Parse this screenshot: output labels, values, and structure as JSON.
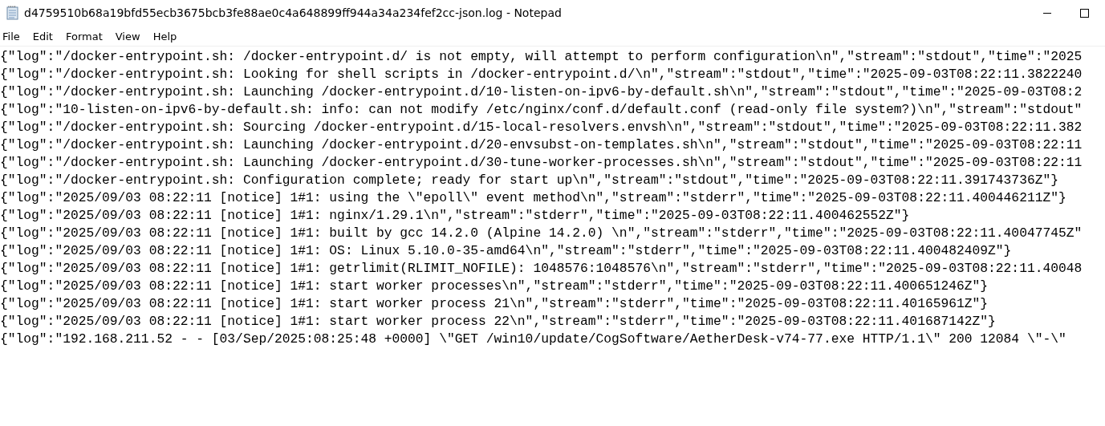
{
  "window": {
    "title": "d4759510b68a19bfd55ecb3675bcb3fe88ae0c4a648899ff944a34a234fef2cc-json.log - Notepad"
  },
  "menu": [
    "File",
    "Edit",
    "Format",
    "View",
    "Help"
  ],
  "lines": [
    "{\"log\":\"/docker-entrypoint.sh: /docker-entrypoint.d/ is not empty, will attempt to perform configuration\\n\",\"stream\":\"stdout\",\"time\":\"2025",
    "{\"log\":\"/docker-entrypoint.sh: Looking for shell scripts in /docker-entrypoint.d/\\n\",\"stream\":\"stdout\",\"time\":\"2025-09-03T08:22:11.3822240",
    "{\"log\":\"/docker-entrypoint.sh: Launching /docker-entrypoint.d/10-listen-on-ipv6-by-default.sh\\n\",\"stream\":\"stdout\",\"time\":\"2025-09-03T08:2",
    "{\"log\":\"10-listen-on-ipv6-by-default.sh: info: can not modify /etc/nginx/conf.d/default.conf (read-only file system?)\\n\",\"stream\":\"stdout\"",
    "{\"log\":\"/docker-entrypoint.sh: Sourcing /docker-entrypoint.d/15-local-resolvers.envsh\\n\",\"stream\":\"stdout\",\"time\":\"2025-09-03T08:22:11.382",
    "{\"log\":\"/docker-entrypoint.sh: Launching /docker-entrypoint.d/20-envsubst-on-templates.sh\\n\",\"stream\":\"stdout\",\"time\":\"2025-09-03T08:22:11",
    "{\"log\":\"/docker-entrypoint.sh: Launching /docker-entrypoint.d/30-tune-worker-processes.sh\\n\",\"stream\":\"stdout\",\"time\":\"2025-09-03T08:22:11",
    "{\"log\":\"/docker-entrypoint.sh: Configuration complete; ready for start up\\n\",\"stream\":\"stdout\",\"time\":\"2025-09-03T08:22:11.391743736Z\"}",
    "{\"log\":\"2025/09/03 08:22:11 [notice] 1#1: using the \\\"epoll\\\" event method\\n\",\"stream\":\"stderr\",\"time\":\"2025-09-03T08:22:11.400446211Z\"}",
    "{\"log\":\"2025/09/03 08:22:11 [notice] 1#1: nginx/1.29.1\\n\",\"stream\":\"stderr\",\"time\":\"2025-09-03T08:22:11.400462552Z\"}",
    "{\"log\":\"2025/09/03 08:22:11 [notice] 1#1: built by gcc 14.2.0 (Alpine 14.2.0) \\n\",\"stream\":\"stderr\",\"time\":\"2025-09-03T08:22:11.40047745Z\"",
    "{\"log\":\"2025/09/03 08:22:11 [notice] 1#1: OS: Linux 5.10.0-35-amd64\\n\",\"stream\":\"stderr\",\"time\":\"2025-09-03T08:22:11.400482409Z\"}",
    "{\"log\":\"2025/09/03 08:22:11 [notice] 1#1: getrlimit(RLIMIT_NOFILE): 1048576:1048576\\n\",\"stream\":\"stderr\",\"time\":\"2025-09-03T08:22:11.40048",
    "{\"log\":\"2025/09/03 08:22:11 [notice] 1#1: start worker processes\\n\",\"stream\":\"stderr\",\"time\":\"2025-09-03T08:22:11.400651246Z\"}",
    "{\"log\":\"2025/09/03 08:22:11 [notice] 1#1: start worker process 21\\n\",\"stream\":\"stderr\",\"time\":\"2025-09-03T08:22:11.40165961Z\"}",
    "{\"log\":\"2025/09/03 08:22:11 [notice] 1#1: start worker process 22\\n\",\"stream\":\"stderr\",\"time\":\"2025-09-03T08:22:11.401687142Z\"}",
    "{\"log\":\"192.168.211.52 - - [03/Sep/2025:08:25:48 +0000] \\\"GET /win10/update/CogSoftware/AetherDesk-v74-77.exe HTTP/1.1\\\" 200 12084 \\\"-\\\""
  ]
}
